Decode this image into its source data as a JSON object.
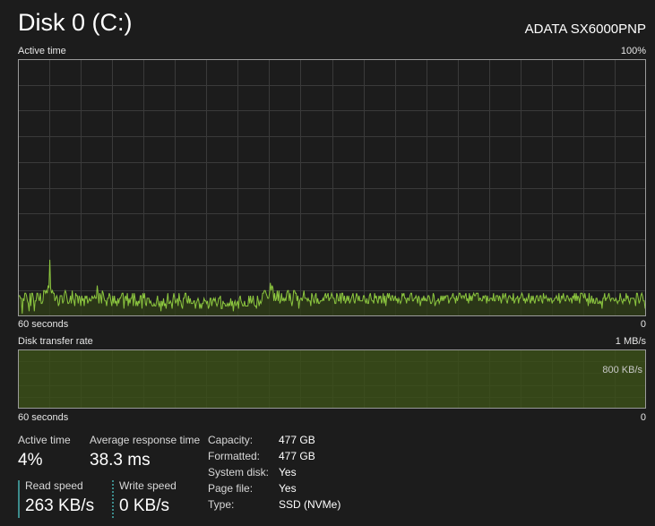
{
  "header": {
    "title": "Disk 0 (C:)",
    "model": "ADATA SX6000PNP"
  },
  "colors": {
    "background": "#1c1c1c",
    "grid": "#3a3a3a",
    "chart_border": "#9a9a9a",
    "active_line": "#8cc63f",
    "active_fill": "#2f3d18",
    "transfer_line": "#a4d24a",
    "transfer_fill": "#3c5118",
    "accent_teal": "#3c8c8c"
  },
  "active_chart": {
    "label": "Active time",
    "max_label": "100%",
    "time_label": "60 seconds",
    "min_label": "0"
  },
  "transfer_chart": {
    "label": "Disk transfer rate",
    "max_label": "1 MB/s",
    "mid_label": "800 KB/s",
    "time_label": "60 seconds",
    "min_label": "0"
  },
  "stats": {
    "active_time_label": "Active time",
    "active_time_value": "4%",
    "response_label": "Average response time",
    "response_value": "38.3 ms",
    "read_label": "Read speed",
    "read_value": "263 KB/s",
    "write_label": "Write speed",
    "write_value": "0 KB/s"
  },
  "properties": [
    {
      "label": "Capacity:",
      "value": "477 GB"
    },
    {
      "label": "Formatted:",
      "value": "477 GB"
    },
    {
      "label": "System disk:",
      "value": "Yes"
    },
    {
      "label": "Page file:",
      "value": "Yes"
    },
    {
      "label": "Type:",
      "value": "SSD (NVMe)"
    }
  ],
  "chart_data": [
    {
      "type": "area",
      "title": "Active time",
      "xlabel": "60 seconds",
      "ylim": [
        0,
        100
      ],
      "unit": "%",
      "series": [
        {
          "values": [
            7,
            8,
            8,
            7,
            7,
            1,
            7,
            6,
            9,
            9,
            8,
            6,
            5,
            2,
            9,
            4,
            9,
            9,
            7,
            2,
            6,
            6,
            9,
            9,
            7,
            6,
            9,
            5,
            5,
            6,
            10,
            10,
            9,
            10,
            9,
            12,
            11,
            22,
            11,
            9,
            10,
            9,
            9,
            6,
            7,
            8,
            7,
            4,
            5,
            8,
            8,
            8,
            5,
            6,
            9,
            10,
            9,
            7,
            5,
            5,
            6,
            8,
            5,
            10,
            7,
            6,
            4,
            9,
            8,
            8,
            5,
            8,
            7,
            4,
            8,
            6,
            7,
            4,
            8,
            7,
            8,
            5,
            6,
            7,
            6,
            6,
            8,
            7,
            7,
            8,
            7,
            7,
            12,
            9,
            5,
            9,
            8,
            5,
            10,
            9,
            7,
            6,
            6,
            4,
            7,
            7,
            9,
            8,
            6,
            4,
            8,
            5,
            8,
            5,
            6,
            4,
            7,
            5,
            7,
            7,
            8,
            9,
            9,
            3,
            7,
            8,
            6,
            9,
            4,
            7,
            5,
            7,
            7,
            9,
            4,
            9,
            7,
            4,
            6,
            4,
            6,
            5,
            8,
            8,
            3,
            9,
            7,
            9,
            5,
            4,
            7,
            7,
            7,
            5,
            6,
            5,
            4,
            4,
            5,
            4,
            4,
            6,
            8,
            5,
            4,
            6,
            2,
            6,
            4,
            7,
            4,
            5,
            3,
            6,
            9,
            5,
            5,
            6,
            5,
            3,
            7,
            9,
            7,
            5,
            6,
            7,
            4,
            9,
            6,
            6,
            4,
            3,
            7,
            7,
            9,
            9,
            6,
            5,
            8,
            5,
            7,
            5,
            5,
            5,
            6,
            6,
            3,
            5,
            6,
            7,
            6,
            3,
            5,
            3,
            5,
            5,
            7,
            6,
            6,
            5,
            6,
            3,
            4,
            7,
            7,
            4,
            6,
            7,
            6,
            7,
            5,
            4,
            5,
            7,
            7,
            8,
            3,
            3,
            6,
            5,
            5,
            4,
            4,
            5,
            4,
            5,
            4,
            7,
            4,
            6,
            2,
            5,
            6,
            4,
            5,
            6,
            3,
            7,
            8,
            6,
            5,
            4,
            4,
            6,
            4,
            4,
            4,
            4,
            8,
            5,
            8,
            5,
            6,
            8,
            5,
            4,
            4,
            3,
            8,
            6,
            4,
            6,
            5,
            6,
            9,
            9,
            10,
            10,
            9,
            8,
            7,
            7,
            9,
            13,
            10,
            12,
            11,
            6,
            9,
            6,
            7,
            10,
            6,
            10,
            5,
            6,
            9,
            6,
            7,
            6,
            7,
            6,
            9,
            10,
            10,
            6,
            9,
            6,
            4,
            6,
            10,
            10,
            9,
            9,
            6,
            8,
            3,
            6,
            7,
            7,
            6,
            8,
            10,
            7,
            7,
            7,
            6,
            7,
            6,
            6,
            4,
            9,
            8,
            6,
            5,
            8,
            9,
            5,
            7,
            5,
            5,
            6,
            6,
            6,
            7,
            6,
            8,
            9,
            7,
            8,
            9,
            6,
            7,
            7,
            9,
            8,
            7,
            7,
            5,
            5,
            9,
            8,
            6,
            6,
            9,
            5,
            9,
            9,
            6,
            8,
            5,
            6,
            8,
            6,
            8,
            5,
            6,
            7,
            8,
            9,
            6,
            5,
            7,
            9,
            8,
            6,
            8,
            6,
            6,
            6,
            6,
            8,
            8,
            6,
            5,
            7,
            5,
            5,
            8,
            9,
            7,
            6,
            6,
            5,
            9,
            7,
            8,
            6,
            5,
            8,
            7,
            8,
            5,
            6,
            9,
            5,
            8,
            4,
            7,
            9,
            7,
            9,
            7,
            6,
            8,
            8,
            6,
            7,
            8,
            6,
            7,
            5,
            7,
            6,
            5,
            6,
            9,
            8,
            9,
            7,
            7,
            5,
            7,
            7,
            6,
            8,
            9,
            9,
            6,
            6,
            7,
            7,
            8,
            7,
            5,
            8,
            7,
            4,
            6,
            7,
            6,
            8,
            6,
            7,
            6,
            6,
            8,
            8,
            7,
            5,
            5,
            6,
            9,
            8,
            4,
            5,
            6,
            6,
            7,
            5,
            6,
            8,
            6,
            8,
            6,
            8,
            7,
            8,
            8,
            8,
            5,
            6,
            7,
            7,
            8,
            9,
            7,
            7,
            5,
            8,
            6,
            7,
            9,
            9,
            8,
            7,
            8,
            8,
            7,
            8,
            9,
            6,
            7,
            5,
            9,
            6,
            8,
            6,
            8,
            9,
            8,
            8,
            9,
            9,
            9,
            6,
            7,
            7,
            6,
            6,
            8,
            7,
            8,
            8,
            5,
            8,
            6,
            6,
            7,
            7,
            7,
            6,
            9,
            6,
            6,
            8,
            8,
            8,
            6,
            8,
            7,
            5,
            7,
            9,
            7,
            8,
            9,
            6,
            5,
            7,
            8,
            8,
            7,
            7,
            6,
            9,
            5,
            6,
            7,
            7,
            8,
            5,
            7,
            7,
            8,
            9,
            8,
            6,
            7,
            5,
            7,
            6,
            7,
            9,
            6,
            5,
            8,
            6,
            8,
            6,
            5,
            7,
            8,
            8,
            6,
            6,
            8,
            8,
            6,
            5,
            9,
            7,
            7,
            8,
            7,
            6,
            7,
            6,
            7,
            7,
            5,
            6,
            6,
            7,
            7,
            8,
            7,
            6,
            9,
            5,
            6,
            8,
            7,
            9,
            7,
            6,
            6,
            8,
            8,
            7,
            6,
            7,
            7,
            5,
            8,
            7,
            9,
            6,
            9,
            6,
            8,
            7,
            5,
            9,
            9,
            9,
            8,
            7,
            9,
            7,
            6,
            7,
            4,
            9,
            5,
            6,
            8,
            5,
            7,
            5,
            5,
            7,
            7,
            5,
            5,
            6,
            5,
            6,
            3,
            7,
            7,
            9,
            6,
            7,
            7,
            8,
            9,
            7,
            6,
            7,
            7,
            7,
            6,
            6,
            7,
            6,
            5,
            6,
            6,
            9,
            7,
            6,
            5,
            7,
            6,
            6,
            9,
            7,
            8,
            6,
            5,
            7,
            7,
            7,
            7,
            7,
            6,
            4,
            9,
            9,
            7,
            5,
            6,
            8,
            9,
            8,
            6,
            6,
            3
          ]
        }
      ]
    },
    {
      "type": "area",
      "title": "Disk transfer rate",
      "xlabel": "60 seconds",
      "ylim": [
        0,
        1000
      ],
      "unit": "KB/s",
      "series": [
        {
          "name": "Read speed",
          "values": [
            1000,
            1000,
            1000,
            1000,
            1000,
            1000,
            1000,
            1000,
            1000,
            1000,
            1000,
            1000,
            1000,
            1000,
            1000,
            1000,
            1000,
            1000,
            1000,
            1000,
            1000,
            1000,
            1000,
            1000,
            1000,
            1000,
            1000,
            1000,
            1000,
            1000,
            1000,
            1000,
            1000,
            1000,
            1000,
            1000,
            1000,
            1000,
            1000,
            1000,
            1000,
            1000,
            1000,
            1000,
            1000,
            1000,
            1000,
            1000,
            1000,
            1000,
            1000,
            1000,
            1000,
            1000,
            1000,
            1000,
            1000,
            1000,
            1000,
            1000
          ]
        },
        {
          "name": "Write speed",
          "values": [
            1000,
            1000,
            1000,
            1000,
            1000,
            1000,
            1000,
            1000,
            1000,
            1000,
            1000,
            1000,
            1000,
            1000,
            1000,
            1000,
            1000,
            1000,
            1000,
            1000,
            1000,
            1000,
            1000,
            1000,
            1000,
            1000,
            1000,
            1000,
            1000,
            1000,
            1000,
            1000,
            1000,
            1000,
            1000,
            1000,
            1000,
            1000,
            1000,
            1000,
            1000,
            1000,
            1000,
            1000,
            1000,
            1000,
            1000,
            1000,
            1000,
            1000,
            1000,
            1000,
            1000,
            1000,
            1000,
            1000,
            1000,
            1000,
            1000,
            1000
          ]
        }
      ]
    }
  ]
}
